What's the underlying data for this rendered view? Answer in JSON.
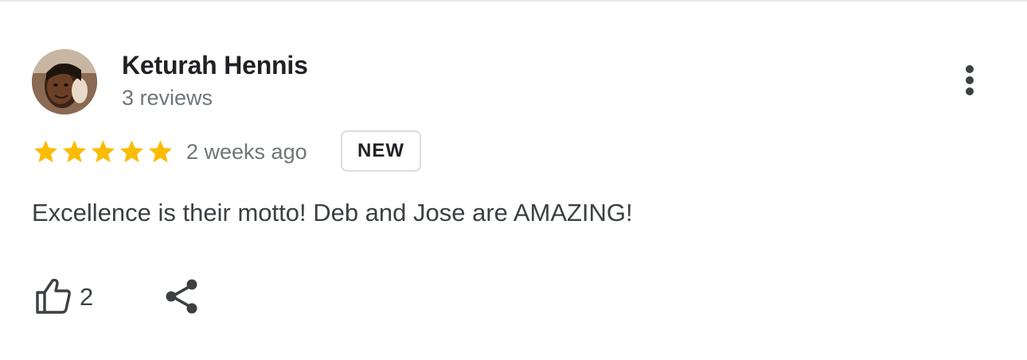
{
  "review": {
    "author": "Keturah Hennis",
    "author_reviews": "3 reviews",
    "rating": 5,
    "rating_max": 5,
    "time_ago": "2 weeks ago",
    "badge": "NEW",
    "text": "Excellence is their motto! Deb and Jose are AMAZING!",
    "like_count": "2"
  },
  "icons": {
    "more": "more-vert-icon",
    "like": "thumbs-up-icon",
    "share": "share-icon",
    "star": "star-icon"
  },
  "colors": {
    "star": "#fbbc04",
    "name": "#202124",
    "secondary": "#70757a",
    "body_text": "#3c4043",
    "badge_border": "#dadce0"
  }
}
